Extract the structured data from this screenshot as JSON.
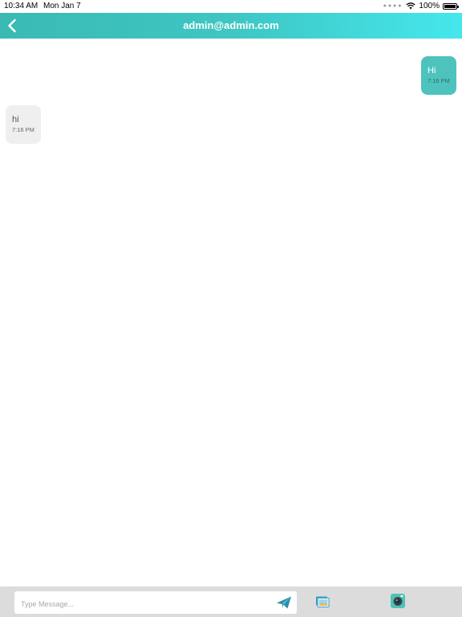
{
  "status_bar": {
    "time": "10:34 AM",
    "date": "Mon Jan 7",
    "battery": "100%"
  },
  "header": {
    "title": "admin@admin.com"
  },
  "messages": [
    {
      "direction": "outgoing",
      "text": "Hi",
      "time": "7:16 PM"
    },
    {
      "direction": "incoming",
      "text": "hi",
      "time": "7:16 PM"
    }
  ],
  "composer": {
    "placeholder": "Type Message...",
    "value": ""
  },
  "icons": {
    "back": "chevron-left-icon",
    "send": "paper-plane-icon",
    "gallery": "gallery-icon",
    "camera": "camera-icon",
    "wifi": "wifi-icon",
    "battery": "battery-icon"
  },
  "colors": {
    "header_gradient_start": "#3bbab4",
    "header_gradient_end": "#45e7ed",
    "outgoing_bubble": "#4ec3bd",
    "incoming_bubble": "#efefef",
    "composer_background": "#dcdcdc"
  }
}
